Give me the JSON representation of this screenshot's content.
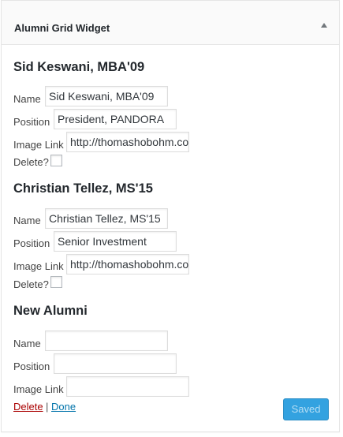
{
  "widget": {
    "title": "Alumni Grid Widget",
    "toggle_icon": "arrow-up-icon"
  },
  "alumni": [
    {
      "heading": "Sid Keswani, MBA'09",
      "name_label": "Name",
      "name_value": "Sid Keswani, MBA'09",
      "position_label": "Position",
      "position_value": "President, PANDORA Americas",
      "image_label": "Image Link",
      "image_value": "http://thomashobohm.com",
      "delete_label": "Delete?"
    },
    {
      "heading": "Christian Tellez, MS'15",
      "name_label": "Name",
      "name_value": "Christian Tellez, MS'15",
      "position_label": "Position",
      "position_value": "Senior Investment Associate",
      "image_label": "Image Link",
      "image_value": "http://thomashobohm.com",
      "delete_label": "Delete?"
    }
  ],
  "new_alumni": {
    "heading": "New Alumni",
    "name_label": "Name",
    "name_value": "",
    "position_label": "Position",
    "position_value": "",
    "image_label": "Image Link",
    "image_value": ""
  },
  "actions": {
    "delete_label": "Delete",
    "separator": "|",
    "done_label": "Done",
    "saved_label": "Saved"
  },
  "colors": {
    "delete_link": "#aa0000",
    "done_link": "#0073aa",
    "saved_button": "#33a2e0"
  }
}
